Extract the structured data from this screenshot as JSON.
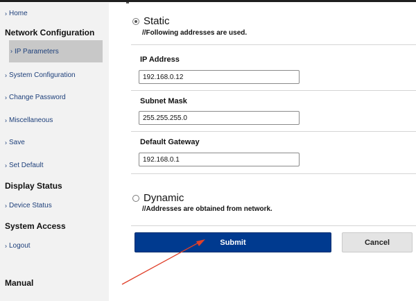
{
  "sidebar": {
    "home": "Home",
    "network_title": "Network Configuration",
    "network_items": [
      "IP Parameters",
      "System Configuration",
      "Change Password",
      "Miscellaneous",
      "Save",
      "Set Default"
    ],
    "display_title": "Display Status",
    "display_items": [
      "Device Status"
    ],
    "access_title": "System Access",
    "access_items": [
      "Logout"
    ],
    "manual_title": "Manual",
    "active_item": "IP Parameters"
  },
  "static_option": {
    "label": "Static",
    "selected": true,
    "note": "//Following addresses are used."
  },
  "fields": {
    "ip_label": "IP Address",
    "ip_value": "192.168.0.12",
    "mask_label": "Subnet Mask",
    "mask_value": "255.255.255.0",
    "gateway_label": "Default Gateway",
    "gateway_value": "192.168.0.1"
  },
  "dynamic_option": {
    "label": "Dynamic",
    "selected": false,
    "note": "//Addresses are obtained from network."
  },
  "buttons": {
    "submit": "Submit",
    "cancel": "Cancel"
  },
  "annotation": {
    "arrow_color": "#e0402a"
  },
  "colors": {
    "primary": "#003a8f",
    "link": "#1d3f7a",
    "sidebar_bg": "#f2f2f2",
    "active_bg": "#c8c8c8"
  }
}
